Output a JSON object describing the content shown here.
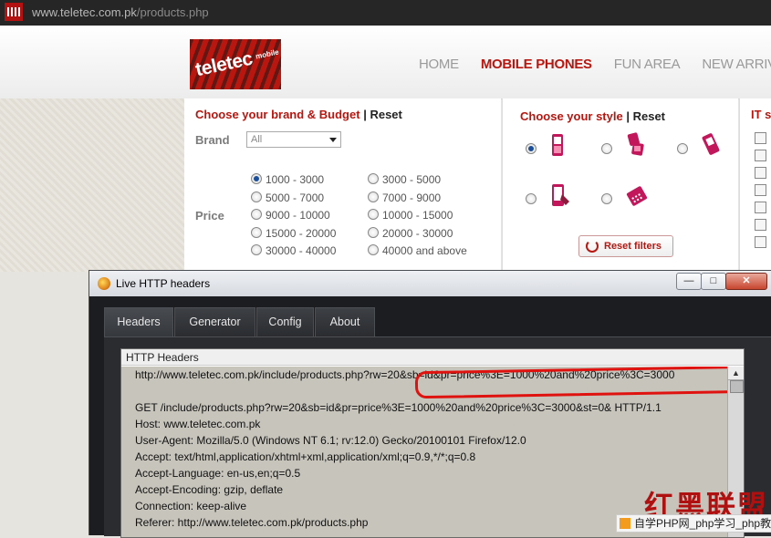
{
  "browser": {
    "url_host": "www.teletec.com.pk",
    "url_path": "/products.php"
  },
  "site": {
    "logo_text": "teletec",
    "logo_sub": "mobile",
    "nav": [
      "HOME",
      "MOBILE PHONES",
      "FUN AREA",
      "NEW ARRIV"
    ],
    "active_nav": "MOBILE PHONES",
    "brand_panel": {
      "title": "Choose your brand & Budget",
      "sep": "|",
      "reset": "Reset",
      "brand_label": "Brand",
      "brand_value": "All",
      "price_label": "Price",
      "price_options_left": [
        "1000 - 3000",
        "5000 - 7000",
        "9000 - 10000",
        "15000 - 20000",
        "30000 - 40000"
      ],
      "price_options_right": [
        "3000 - 5000",
        "7000 - 9000",
        "10000 - 15000",
        "20000 - 30000",
        "40000 and above"
      ],
      "selected_price": "1000 - 3000"
    },
    "style_panel": {
      "title": "Choose your style",
      "sep": "|",
      "reset": "Reset",
      "reset_filters": "Reset filters",
      "styles": [
        "bar-phone-icon",
        "flip-phone-icon",
        "slider-phone-icon",
        "touch-phone-icon",
        "qwerty-phone-icon"
      ],
      "selected_style": 0
    },
    "it_panel": {
      "title": "IT st"
    }
  },
  "window": {
    "title": "Live HTTP headers",
    "tabs": [
      "Headers",
      "Generator",
      "Config",
      "About"
    ],
    "active_tab": "Headers",
    "box_title": "HTTP Headers",
    "lines": [
      "http://www.teletec.com.pk/include/products.php?rw=20&sb=id&pr=price%3E=1000%20and%20price%3C=3000",
      "",
      "GET /include/products.php?rw=20&sb=id&pr=price%3E=1000%20and%20price%3C=3000&st=0& HTTP/1.1",
      "Host: www.teletec.com.pk",
      "User-Agent: Mozilla/5.0 (Windows NT 6.1; rv:12.0) Gecko/20100101 Firefox/12.0",
      "Accept: text/html,application/xhtml+xml,application/xml;q=0.9,*/*;q=0.8",
      "Accept-Language: en-us,en;q=0.5",
      "Accept-Encoding: gzip, deflate",
      "Connection: keep-alive",
      "Referer: http://www.teletec.com.pk/products.php"
    ]
  },
  "watermark": {
    "chinese": "红黑联盟",
    "bar_text": "自学PHP网_php学习_php教"
  }
}
